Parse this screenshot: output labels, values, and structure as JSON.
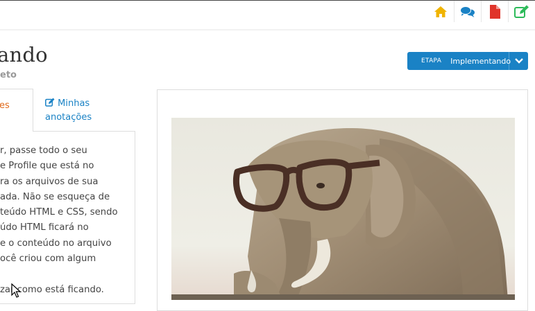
{
  "topbar": {
    "icons": [
      "home-icon",
      "comments-icon",
      "pdf-file-icon",
      "edit-icon"
    ],
    "colors": {
      "home": "#f0b400",
      "comments": "#1a82c5",
      "pdf": "#e0342a",
      "edit": "#2dbb5a"
    }
  },
  "header": {
    "title": "ando",
    "subtitle": "eto"
  },
  "etapa": {
    "label": "ETAPA",
    "value": "Implementando",
    "color": "#1a82c5"
  },
  "tabs": {
    "active": "es",
    "notes_line1": "Minhas",
    "notes_line2": "anotações"
  },
  "content": {
    "lines": [
      "r, passe todo o seu",
      "e Profile que está no",
      "ra os arquivos de sua",
      "ada. Não se esqueça de",
      "teúdo HTML e CSS, sendo",
      "údo HTML ficará no",
      "e o conteúdo no arquivo",
      "ocê criou com algum",
      "",
      "zar como está ficando."
    ]
  },
  "image": {
    "subject": "elephant statue wearing glasses"
  }
}
